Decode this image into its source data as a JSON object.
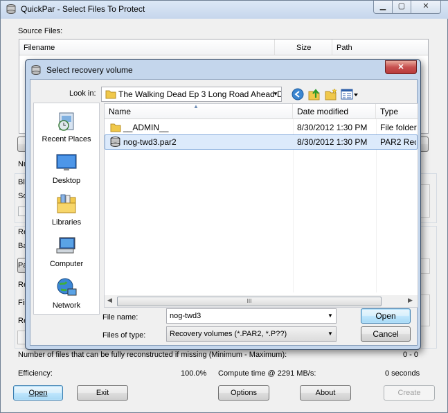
{
  "main_window": {
    "title": "QuickPar - Select Files To Protect",
    "source_files_label": "Source Files:",
    "columns": [
      "Filename",
      "Size",
      "Path"
    ],
    "partial_labels": [
      "Nu",
      "Blo",
      "So",
      "Re",
      "Ba",
      "Re",
      "Fir",
      "Re"
    ],
    "partial_buttons": [
      "Pa"
    ],
    "reconstruct_label": "Number of files that can be fully reconstructed if missing (Minimum - Maximum):",
    "reconstruct_value": "0 - 0",
    "efficiency_label": "Efficiency:",
    "efficiency_value": "100.0%",
    "compute_label": "Compute time @ 2291 MB/s:",
    "compute_value": "0 seconds",
    "buttons": {
      "open": "Open",
      "exit": "Exit",
      "options": "Options",
      "about": "About",
      "create": "Create"
    }
  },
  "dialog": {
    "title": "Select recovery volume",
    "look_in_label": "Look in:",
    "look_in_value": "The Walking Dead Ep 3 Long Road Ahead D",
    "places": [
      {
        "label": "Recent Places",
        "icon": "recent-places-icon"
      },
      {
        "label": "Desktop",
        "icon": "desktop-icon"
      },
      {
        "label": "Libraries",
        "icon": "libraries-icon"
      },
      {
        "label": "Computer",
        "icon": "computer-icon"
      },
      {
        "label": "Network",
        "icon": "network-icon"
      }
    ],
    "columns": {
      "name": "Name",
      "date": "Date modified",
      "type": "Type"
    },
    "files": [
      {
        "name": "__ADMIN__",
        "date": "8/30/2012 1:30 PM",
        "type": "File folder",
        "icon": "folder-icon"
      },
      {
        "name": "nog-twd3.par2",
        "date": "8/30/2012 1:30 PM",
        "type": "PAR2 Reco",
        "icon": "par2-file-icon"
      }
    ],
    "file_name_label": "File name:",
    "file_name_value": "nog-twd3",
    "file_type_label": "Files of type:",
    "file_type_value": "Recovery volumes (*.PAR2, *.P??)",
    "open_button": "Open",
    "cancel_button": "Cancel",
    "close_glyph": "✕",
    "scroll_thumb_glyph": "III"
  }
}
